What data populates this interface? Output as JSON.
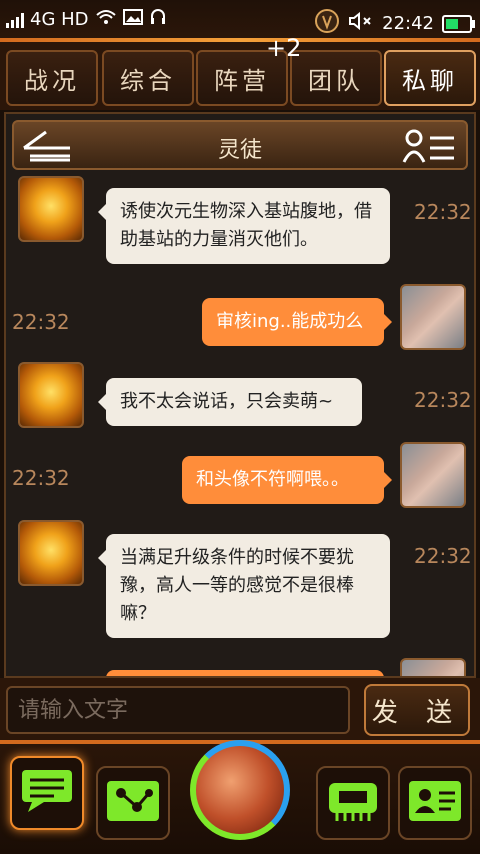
{
  "status": {
    "network": "4G HD",
    "time": "22:42"
  },
  "tabs": [
    {
      "label": "战况"
    },
    {
      "label": "综合"
    },
    {
      "label": "阵营"
    },
    {
      "label": "团队"
    },
    {
      "label": "私聊"
    }
  ],
  "tab_badge": "+2",
  "chat": {
    "title": "灵徒",
    "messages": [
      {
        "from": "them",
        "text": "诱使次元生物深入基站腹地，借助基站的力量消灭他们。",
        "time": "22:32"
      },
      {
        "from": "me",
        "text": "审核ing..能成功么",
        "time": "22:32"
      },
      {
        "from": "them",
        "text": "我不太会说话，只会卖萌~",
        "time": "22:32"
      },
      {
        "from": "me",
        "text": "和头像不符啊喂。。",
        "time": "22:32"
      },
      {
        "from": "them",
        "text": "当满足升级条件的时候不要犹豫，高人一等的感觉不是很棒嘛？",
        "time": "22:32"
      }
    ]
  },
  "input": {
    "placeholder": "请输入文字"
  },
  "send_label": "发 送",
  "colors": {
    "accent": "#ff8d3a",
    "frame": "#8a5a2e",
    "active_green": "#7ee82a"
  }
}
